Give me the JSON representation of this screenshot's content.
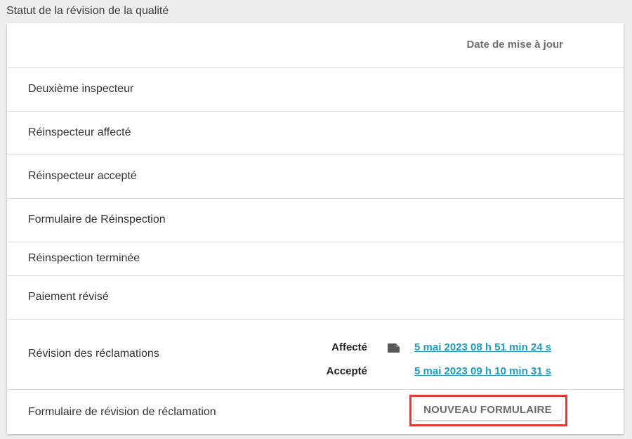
{
  "section": {
    "title": "Statut de la révision de la qualité"
  },
  "table": {
    "header_date": "Date de mise à jour",
    "rows": [
      {
        "label": "Deuxième inspecteur"
      },
      {
        "label": "Réinspecteur affecté"
      },
      {
        "label": "Réinspecteur accepté"
      },
      {
        "label": "Formulaire de Réinspection"
      },
      {
        "label": "Réinspection terminée"
      },
      {
        "label": "Paiement révisé"
      },
      {
        "label": "Révision des réclamations"
      },
      {
        "label": "Formulaire de révision de réclamation"
      }
    ],
    "claims_review": {
      "assigned_label": "Affecté",
      "assigned_date": "5 mai 2023 08 h 51 min 24 s",
      "accepted_label": "Accepté",
      "accepted_date": "5 mai 2023 09 h 10 min 31 s",
      "file_icon": "file-icon"
    },
    "new_form_button": "NOUVEAU FORMULAIRE"
  },
  "colors": {
    "link": "#1a9bc7",
    "highlight_border": "#e53935",
    "background": "#eeeeee"
  }
}
